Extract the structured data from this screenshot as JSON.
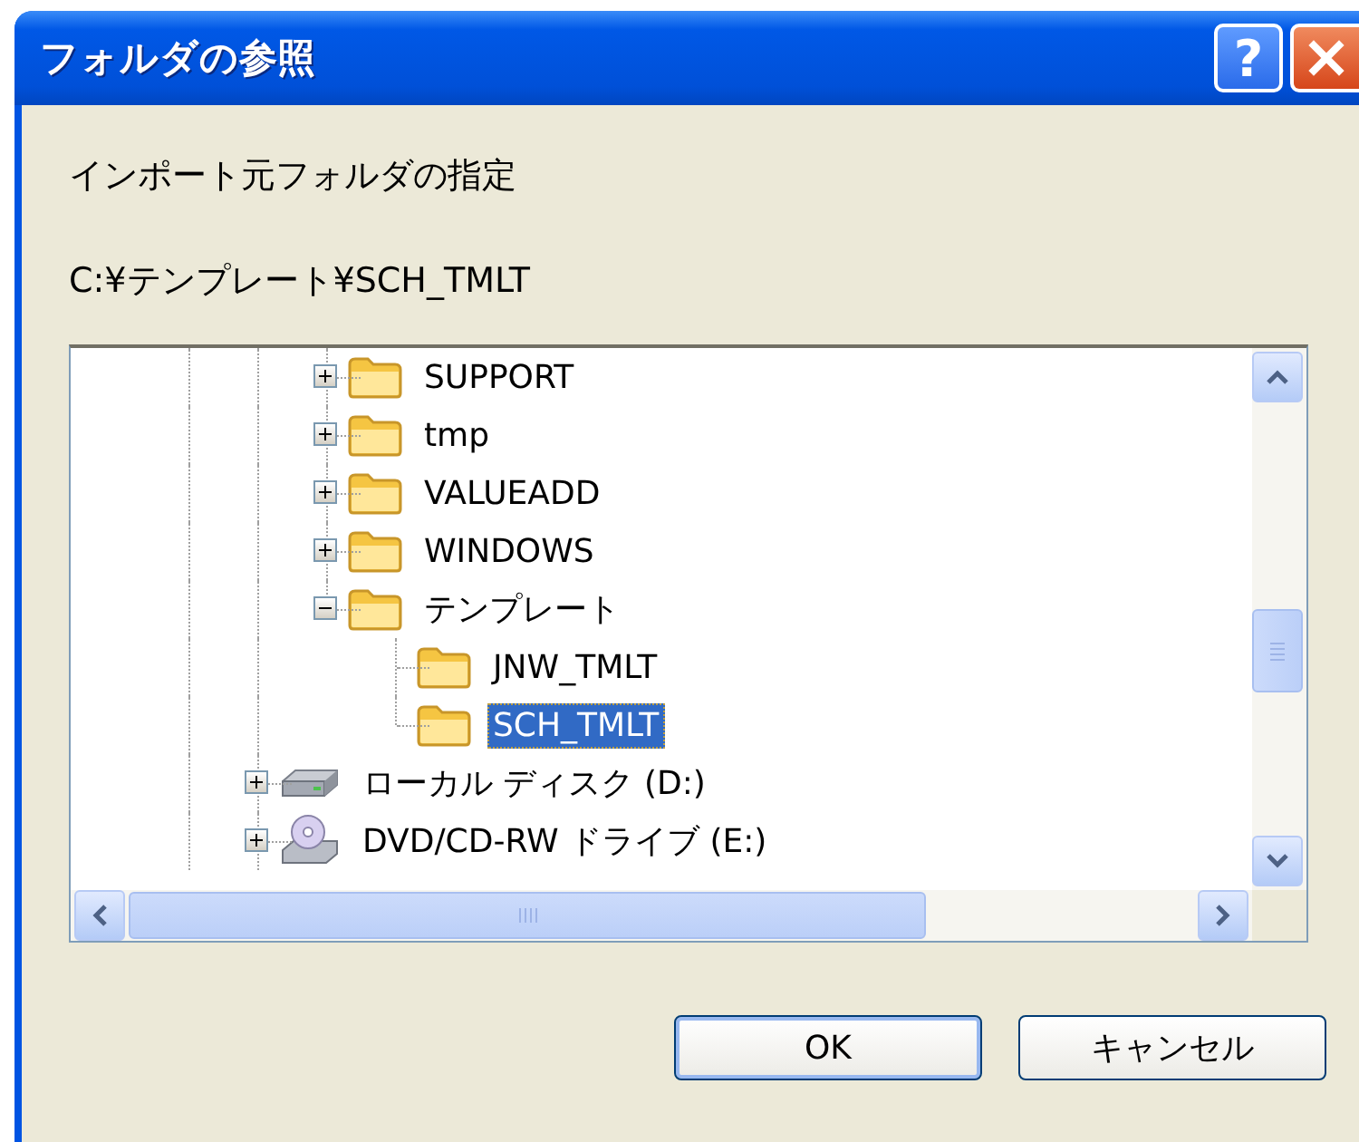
{
  "window": {
    "title": "フォルダの参照",
    "help_button": "?"
  },
  "instruction": "インポート元フォルダの指定",
  "path": "C:¥テンプレート¥SCH_TMLT",
  "tree": {
    "items": [
      {
        "children": [
          {
            "label": "SUPPORT",
            "kind": "folder",
            "expanded": false,
            "selected": false
          },
          {
            "label": "tmp",
            "kind": "folder",
            "expanded": false,
            "selected": false
          },
          {
            "label": "VALUEADD",
            "kind": "folder",
            "expanded": false,
            "selected": false
          },
          {
            "label": "WINDOWS",
            "kind": "folder",
            "expanded": false,
            "selected": false
          },
          {
            "label": "テンプレート",
            "kind": "folder",
            "expanded": true,
            "selected": false,
            "children": [
              {
                "label": "JNW_TMLT",
                "kind": "folder",
                "selected": false
              },
              {
                "label": "SCH_TMLT",
                "kind": "folder",
                "selected": true
              }
            ]
          }
        ]
      },
      {
        "label": "ローカル ディスク (D:)",
        "kind": "harddisk",
        "expanded": false,
        "selected": false
      },
      {
        "label": "DVD/CD-RW ドライブ (E:)",
        "kind": "cdrom",
        "expanded": false,
        "selected": false
      }
    ]
  },
  "buttons": [
    {
      "label": "OK",
      "default": true
    },
    {
      "label": "キャンセル",
      "default": false
    }
  ]
}
